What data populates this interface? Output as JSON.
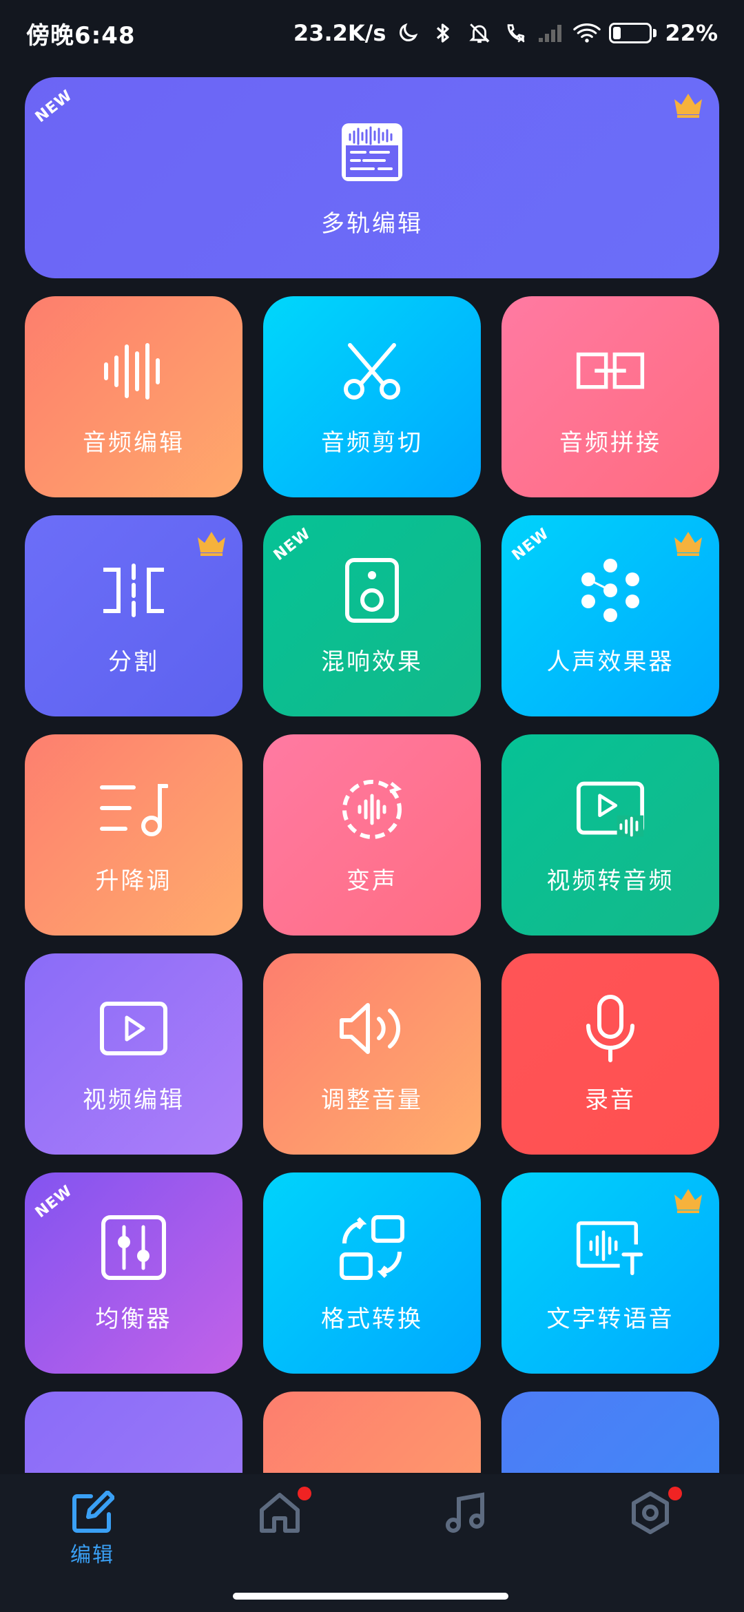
{
  "status_bar": {
    "time": "傍晚6:48",
    "net_speed": "23.2K/s",
    "battery_percent": "22%",
    "battery_level": 0.22
  },
  "hero": {
    "label": "多轨编辑",
    "badge_new": "NEW",
    "crown": true,
    "icon": "multitrack-editor-icon"
  },
  "tiles": [
    {
      "label": "音频编辑",
      "icon": "waveform-icon",
      "new": "",
      "crown": false
    },
    {
      "label": "音频剪切",
      "icon": "scissors-icon",
      "new": "",
      "crown": false
    },
    {
      "label": "音频拼接",
      "icon": "merge-blocks-icon",
      "new": "",
      "crown": false
    },
    {
      "label": "分割",
      "icon": "split-icon",
      "new": "",
      "crown": true
    },
    {
      "label": "混响效果",
      "icon": "speaker-icon",
      "new": "NEW",
      "crown": false
    },
    {
      "label": "人声效果器",
      "icon": "dots-effect-icon",
      "new": "NEW",
      "crown": true
    },
    {
      "label": "升降调",
      "icon": "pitch-note-icon",
      "new": "",
      "crown": false
    },
    {
      "label": "变声",
      "icon": "voice-change-icon",
      "new": "",
      "crown": false
    },
    {
      "label": "视频转音频",
      "icon": "video-to-audio-icon",
      "new": "",
      "crown": false
    },
    {
      "label": "视频编辑",
      "icon": "video-play-icon",
      "new": "",
      "crown": false
    },
    {
      "label": "调整音量",
      "icon": "volume-icon",
      "new": "",
      "crown": false
    },
    {
      "label": "录音",
      "icon": "microphone-icon",
      "new": "",
      "crown": false
    },
    {
      "label": "均衡器",
      "icon": "equalizer-icon",
      "new": "NEW",
      "crown": false
    },
    {
      "label": "格式转换",
      "icon": "format-convert-icon",
      "new": "",
      "crown": false
    },
    {
      "label": "文字转语音",
      "icon": "text-to-speech-icon",
      "new": "",
      "crown": true
    }
  ],
  "nav": {
    "edit_label": "编辑",
    "items": [
      "edit-icon",
      "home-icon",
      "music-note-icon",
      "settings-hex-icon"
    ]
  },
  "colors": {
    "accent_blue": "#3aa0f5",
    "crown": "#f6b23c",
    "red_dot": "#f02323"
  }
}
